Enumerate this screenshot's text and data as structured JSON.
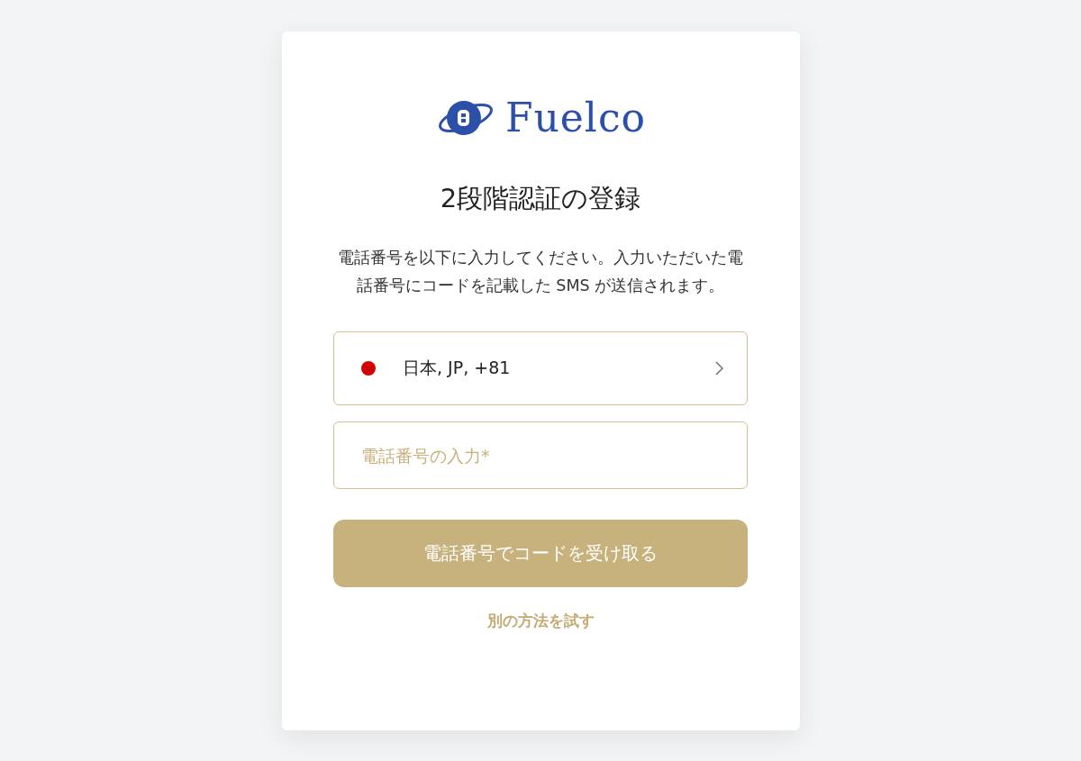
{
  "logo": {
    "text": "Fuelco"
  },
  "title": "2段階認証の登録",
  "description": "電話番号を以下に入力してください。入力いただいた電話番号にコードを記載した SMS が送信されます。",
  "country_select": {
    "value": "日本, JP, +81"
  },
  "phone_field": {
    "placeholder": "電話番号の入力*"
  },
  "submit_button": {
    "label": "電話番号でコードを受け取る"
  },
  "alt_link": {
    "label": "別の方法を試す"
  }
}
